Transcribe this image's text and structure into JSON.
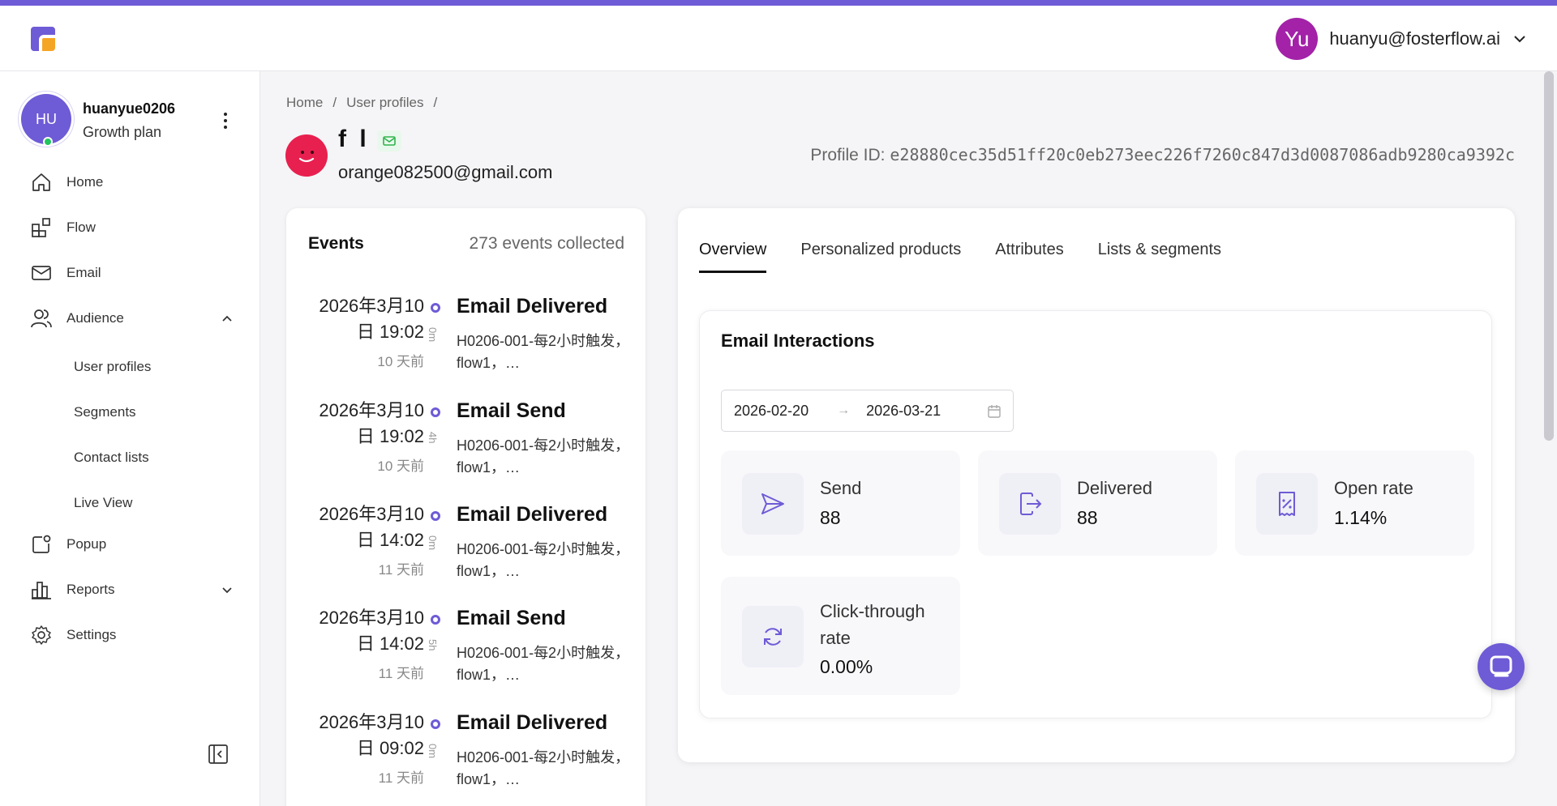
{
  "header": {
    "user_initials": "Yu",
    "user_email": "huanyu@fosterflow.ai"
  },
  "sidebar": {
    "profile": {
      "initials": "HU",
      "username": "huanyue0206",
      "plan": "Growth plan"
    },
    "items": [
      {
        "label": "Home",
        "icon": "home-icon"
      },
      {
        "label": "Flow",
        "icon": "flow-icon"
      },
      {
        "label": "Email",
        "icon": "mail-icon"
      },
      {
        "label": "Audience",
        "icon": "users-icon"
      },
      {
        "label": "Popup",
        "icon": "popup-icon"
      },
      {
        "label": "Reports",
        "icon": "chart-icon"
      },
      {
        "label": "Settings",
        "icon": "gear-icon"
      }
    ],
    "audience_sub": [
      "User profiles",
      "Segments",
      "Contact lists",
      "Live View"
    ]
  },
  "breadcrumb": {
    "home": "Home",
    "sep": "/",
    "current": "User profiles"
  },
  "contact": {
    "name": "f l",
    "email": "orange082500@gmail.com",
    "profile_id_label": "Profile ID:",
    "profile_id": "e28880cec35d51ff20c0eb273eec226f7260c847d3d0087086adb9280ca9392c"
  },
  "events": {
    "title": "Events",
    "count_text": "273 events collected",
    "items": [
      {
        "date_line1": "2026年3月10",
        "date_line2": "日 19:02",
        "ago": "10 天前",
        "duration": "0m",
        "name": "Email Delivered",
        "desc": "H0206-001-每2小时触发，flow1，…"
      },
      {
        "date_line1": "2026年3月10",
        "date_line2": "日 19:02",
        "ago": "10 天前",
        "duration": "4h",
        "name": "Email Send",
        "desc": "H0206-001-每2小时触发，flow1，…"
      },
      {
        "date_line1": "2026年3月10",
        "date_line2": "日 14:02",
        "ago": "11 天前",
        "duration": "0m",
        "name": "Email Delivered",
        "desc": "H0206-001-每2小时触发，flow1，…"
      },
      {
        "date_line1": "2026年3月10",
        "date_line2": "日 14:02",
        "ago": "11 天前",
        "duration": "5h",
        "name": "Email Send",
        "desc": "H0206-001-每2小时触发，flow1，…"
      },
      {
        "date_line1": "2026年3月10",
        "date_line2": "日 09:02",
        "ago": "11 天前",
        "duration": "0m",
        "name": "Email Delivered",
        "desc": "H0206-001-每2小时触发，flow1，…"
      }
    ]
  },
  "overview": {
    "tabs": [
      "Overview",
      "Personalized products",
      "Attributes",
      "Lists & segments"
    ],
    "active_tab": "Overview",
    "interactions": {
      "title": "Email Interactions",
      "date_from": "2026-02-20",
      "date_to": "2026-03-21",
      "stats": [
        {
          "label": "Send",
          "value": "88",
          "icon": "send-icon"
        },
        {
          "label": "Delivered",
          "value": "88",
          "icon": "delivered-icon"
        },
        {
          "label": "Open rate",
          "value": "1.14%",
          "icon": "receipt-percent-icon"
        },
        {
          "label": "Click-through rate",
          "value": "0.00%",
          "icon": "refresh-icon"
        }
      ]
    }
  },
  "colors": {
    "accent": "#6e5bd6",
    "avatar_yu": "#a322a8",
    "contact_avatar": "#e8204f",
    "online": "#22c55e"
  }
}
